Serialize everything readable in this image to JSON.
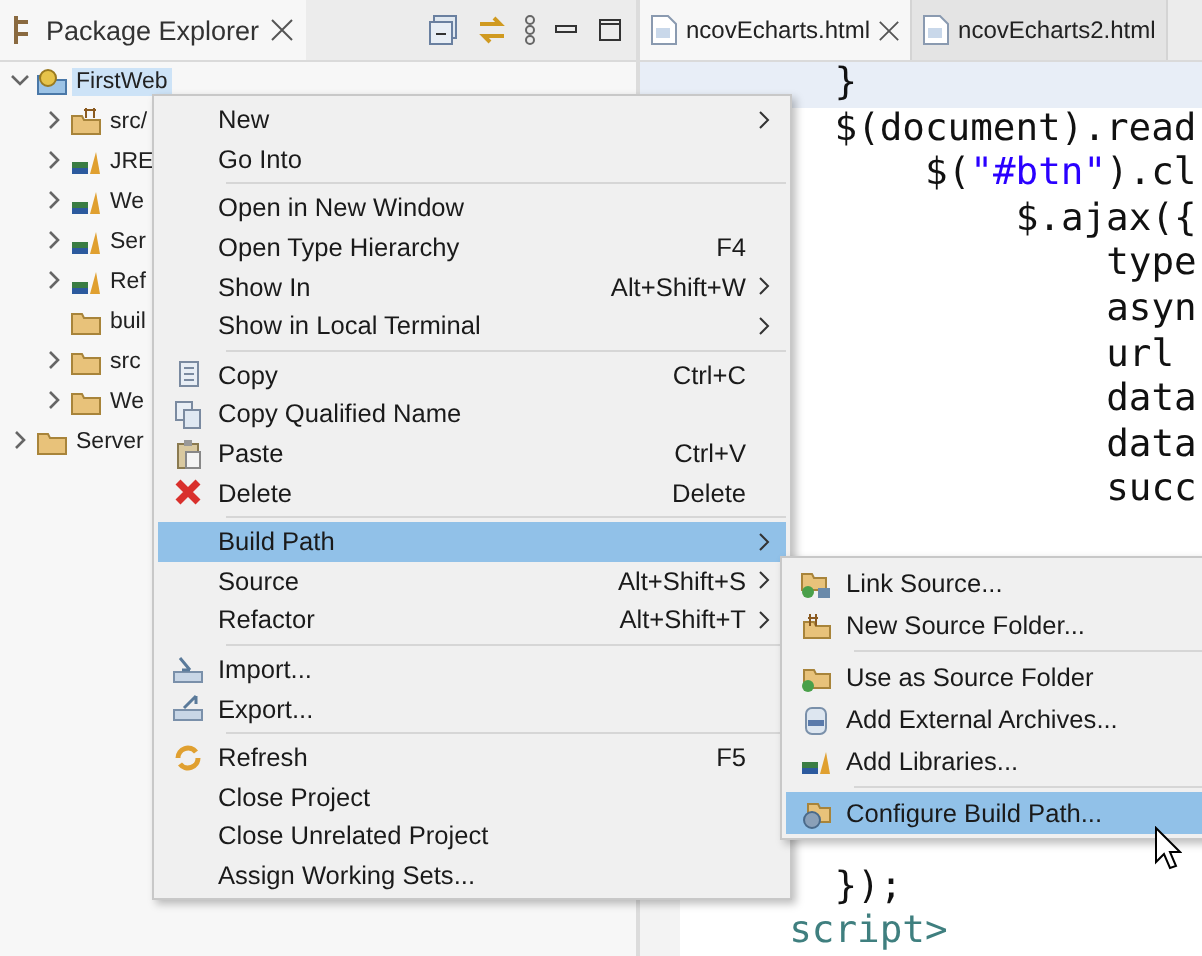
{
  "package_explorer": {
    "title": "Package Explorer",
    "tree": [
      {
        "label": "FirstWeb",
        "expanded": true,
        "selected": true,
        "children": [
          {
            "label": "src/",
            "expandable": true
          },
          {
            "label": "JRE",
            "expandable": true
          },
          {
            "label": "We",
            "expandable": true
          },
          {
            "label": "Ser",
            "expandable": true
          },
          {
            "label": "Ref",
            "expandable": true
          },
          {
            "label": "buil",
            "expandable": false
          },
          {
            "label": "src",
            "expandable": true
          },
          {
            "label": "We",
            "expandable": true
          }
        ]
      },
      {
        "label": "Server",
        "expanded": false,
        "selected": false
      }
    ]
  },
  "editor": {
    "tabs": [
      {
        "label": "ncovEcharts.html",
        "selected": true,
        "closable": true
      },
      {
        "label": "ncovEcharts2.html",
        "selected": false,
        "closable": false
      }
    ],
    "lines_top": [
      {
        "current": true,
        "tokens": [
          {
            "text": "    }",
            "kind": "plain"
          }
        ]
      },
      {
        "current": false,
        "tokens": [
          {
            "text": "    $(document).read",
            "kind": "plain"
          }
        ]
      },
      {
        "current": false,
        "tokens": [
          {
            "text": "        $(",
            "kind": "plain"
          },
          {
            "text": "\"#btn\"",
            "kind": "string"
          },
          {
            "text": ").cl",
            "kind": "plain"
          }
        ]
      },
      {
        "current": false,
        "tokens": [
          {
            "text": "            $.ajax({",
            "kind": "plain"
          }
        ]
      },
      {
        "current": false,
        "tokens": [
          {
            "text": "                type",
            "kind": "plain"
          }
        ]
      },
      {
        "current": false,
        "tokens": [
          {
            "text": "                asyn",
            "kind": "plain"
          }
        ]
      },
      {
        "current": false,
        "tokens": [
          {
            "text": "                url",
            "kind": "plain"
          }
        ]
      },
      {
        "current": false,
        "tokens": [
          {
            "text": "                data",
            "kind": "plain"
          }
        ]
      },
      {
        "current": false,
        "tokens": [
          {
            "text": "                data",
            "kind": "plain"
          }
        ]
      },
      {
        "current": false,
        "tokens": [
          {
            "text": "                succ",
            "kind": "plain"
          }
        ]
      }
    ],
    "lines_bottom": [
      {
        "current": false,
        "tokens": [
          {
            "text": "    });",
            "kind": "plain"
          }
        ]
      },
      {
        "current": false,
        "tokens": [
          {
            "text": "  script>",
            "kind": "tag"
          }
        ]
      }
    ]
  },
  "context_menu": {
    "items": [
      {
        "kind": "item",
        "label": "New",
        "has_submenu": true,
        "selected": false
      },
      {
        "kind": "item",
        "label": "Go Into",
        "has_submenu": false,
        "selected": false
      },
      {
        "kind": "separator"
      },
      {
        "kind": "item",
        "label": "Open in New Window",
        "has_submenu": false,
        "selected": false
      },
      {
        "kind": "item",
        "label": "Open Type Hierarchy",
        "shortcut": "F4",
        "has_submenu": false,
        "selected": false
      },
      {
        "kind": "item",
        "label": "Show In",
        "shortcut": "Alt+Shift+W",
        "has_submenu": true,
        "selected": false
      },
      {
        "kind": "item",
        "label": "Show in Local Terminal",
        "has_submenu": true,
        "selected": false
      },
      {
        "kind": "separator"
      },
      {
        "kind": "item",
        "label": "Copy",
        "shortcut": "Ctrl+C",
        "has_submenu": false,
        "selected": false
      },
      {
        "kind": "item",
        "label": "Copy Qualified Name",
        "has_submenu": false,
        "selected": false
      },
      {
        "kind": "item",
        "label": "Paste",
        "shortcut": "Ctrl+V",
        "has_submenu": false,
        "selected": false
      },
      {
        "kind": "item",
        "label": "Delete",
        "shortcut": "Delete",
        "has_submenu": false,
        "selected": false
      },
      {
        "kind": "separator"
      },
      {
        "kind": "item",
        "label": "Build Path",
        "has_submenu": true,
        "selected": true
      },
      {
        "kind": "item",
        "label": "Source",
        "shortcut": "Alt+Shift+S",
        "has_submenu": true,
        "selected": false
      },
      {
        "kind": "item",
        "label": "Refactor",
        "shortcut": "Alt+Shift+T",
        "has_submenu": true,
        "selected": false
      },
      {
        "kind": "separator"
      },
      {
        "kind": "item",
        "label": "Import...",
        "has_submenu": false,
        "selected": false
      },
      {
        "kind": "item",
        "label": "Export...",
        "has_submenu": false,
        "selected": false
      },
      {
        "kind": "separator"
      },
      {
        "kind": "item",
        "label": "Refresh",
        "shortcut": "F5",
        "has_submenu": false,
        "selected": false
      },
      {
        "kind": "item",
        "label": "Close Project",
        "has_submenu": false,
        "selected": false
      },
      {
        "kind": "item",
        "label": "Close Unrelated Project",
        "has_submenu": false,
        "selected": false
      },
      {
        "kind": "item",
        "label": "Assign Working Sets...",
        "has_submenu": false,
        "selected": false
      }
    ]
  },
  "build_path_submenu": {
    "items": [
      {
        "kind": "item",
        "label": "Link Source...",
        "selected": false
      },
      {
        "kind": "item",
        "label": "New Source Folder...",
        "selected": false
      },
      {
        "kind": "separator"
      },
      {
        "kind": "item",
        "label": "Use as Source Folder",
        "selected": false
      },
      {
        "kind": "item",
        "label": "Add External Archives...",
        "selected": false
      },
      {
        "kind": "item",
        "label": "Add Libraries...",
        "selected": false
      },
      {
        "kind": "separator"
      },
      {
        "kind": "item",
        "label": "Configure Build Path...",
        "selected": true
      }
    ]
  }
}
